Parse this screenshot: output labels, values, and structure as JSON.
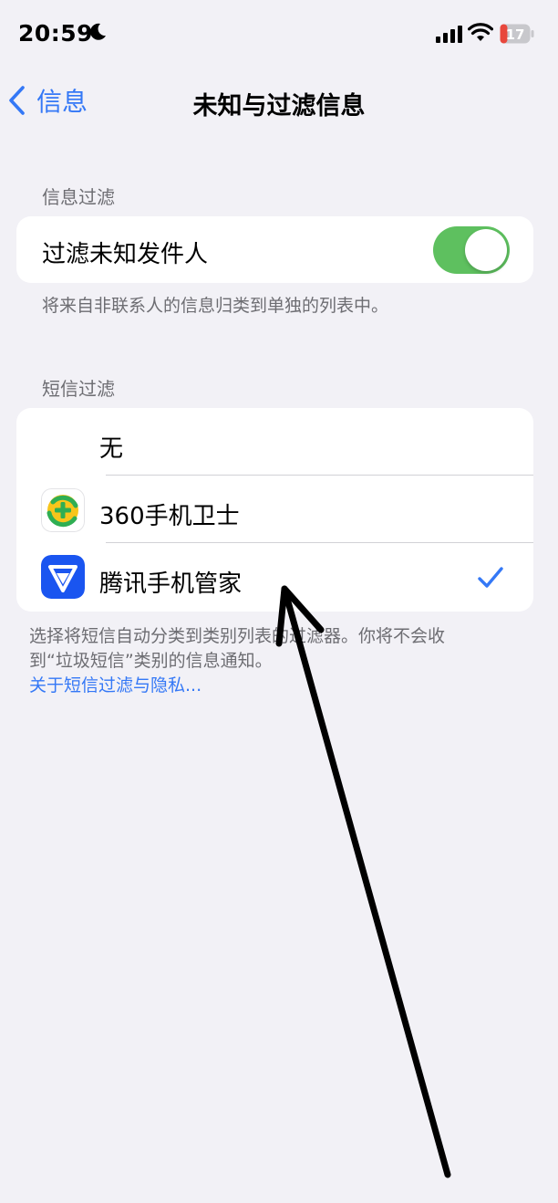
{
  "status_bar": {
    "time": "20:59",
    "battery_level": "17"
  },
  "nav": {
    "back_label": "信息",
    "title": "未知与过滤信息"
  },
  "message_filtering": {
    "header": "信息过滤",
    "toggle_label": "过滤未知发件人",
    "toggle_on": true,
    "footer": "将来自非联系人的信息归类到单独的列表中。"
  },
  "sms_filtering": {
    "header": "短信过滤",
    "options": [
      {
        "label": "无",
        "icon": "none"
      },
      {
        "label": "360手机卫士",
        "icon": "360-security-app-icon"
      },
      {
        "label": "腾讯手机管家",
        "icon": "tencent-manager-app-icon",
        "selected": true
      }
    ],
    "footer_line1": "选择将短信自动分类到类别列表的过滤器。你将不会收",
    "footer_line2": "到“垃圾短信”类别的信息通知。",
    "link": "关于短信过滤与隐私..."
  },
  "colors": {
    "accent": "#3478f6",
    "toggle_on": "#5ec05f",
    "background": "#f2f1f6"
  }
}
